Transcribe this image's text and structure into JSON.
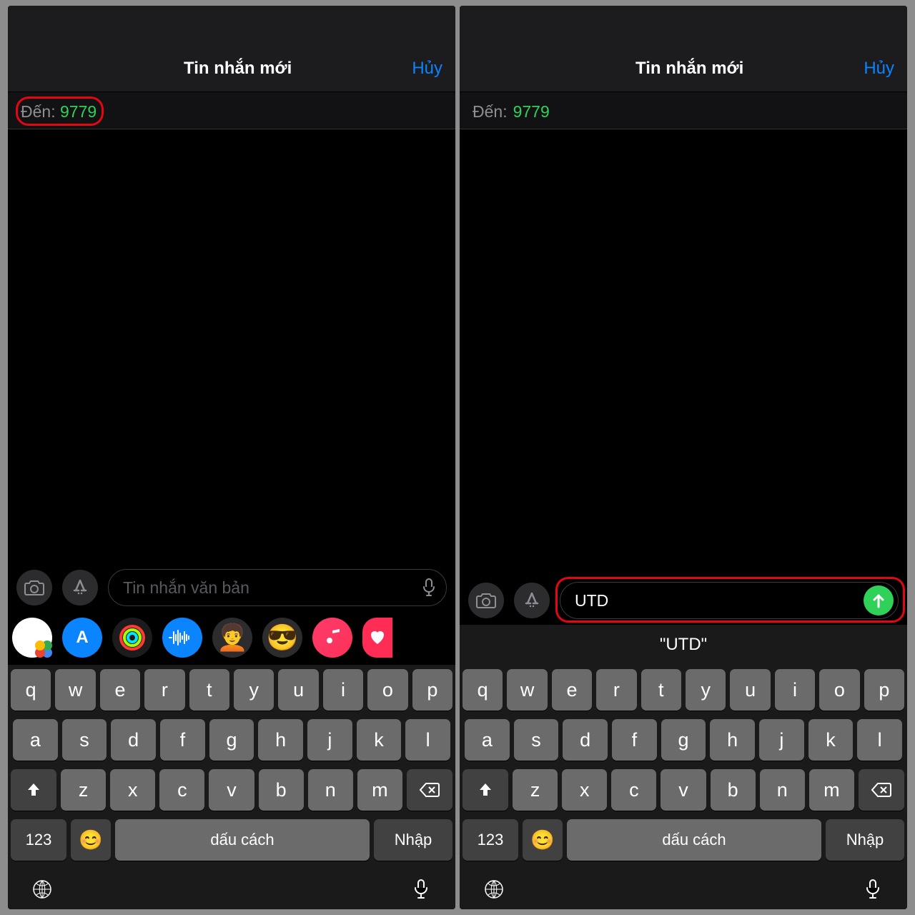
{
  "left": {
    "header_title": "Tin nhắn mới",
    "cancel_label": "Hủy",
    "recipient_label": "Đến:",
    "recipient_value": "9779",
    "input_placeholder": "Tin nhắn văn bản"
  },
  "right": {
    "header_title": "Tin nhắn mới",
    "cancel_label": "Hủy",
    "recipient_label": "Đến:",
    "recipient_value": "9779",
    "input_value": "UTD",
    "suggestion": "\"UTD\""
  },
  "keyboard": {
    "row1": [
      "q",
      "w",
      "e",
      "r",
      "t",
      "y",
      "u",
      "i",
      "o",
      "p"
    ],
    "row2": [
      "a",
      "s",
      "d",
      "f",
      "g",
      "h",
      "j",
      "k",
      "l"
    ],
    "row3": [
      "z",
      "x",
      "c",
      "v",
      "b",
      "n",
      "m"
    ],
    "numbers_label": "123",
    "space_label": "dấu cách",
    "enter_label": "Nhập"
  }
}
